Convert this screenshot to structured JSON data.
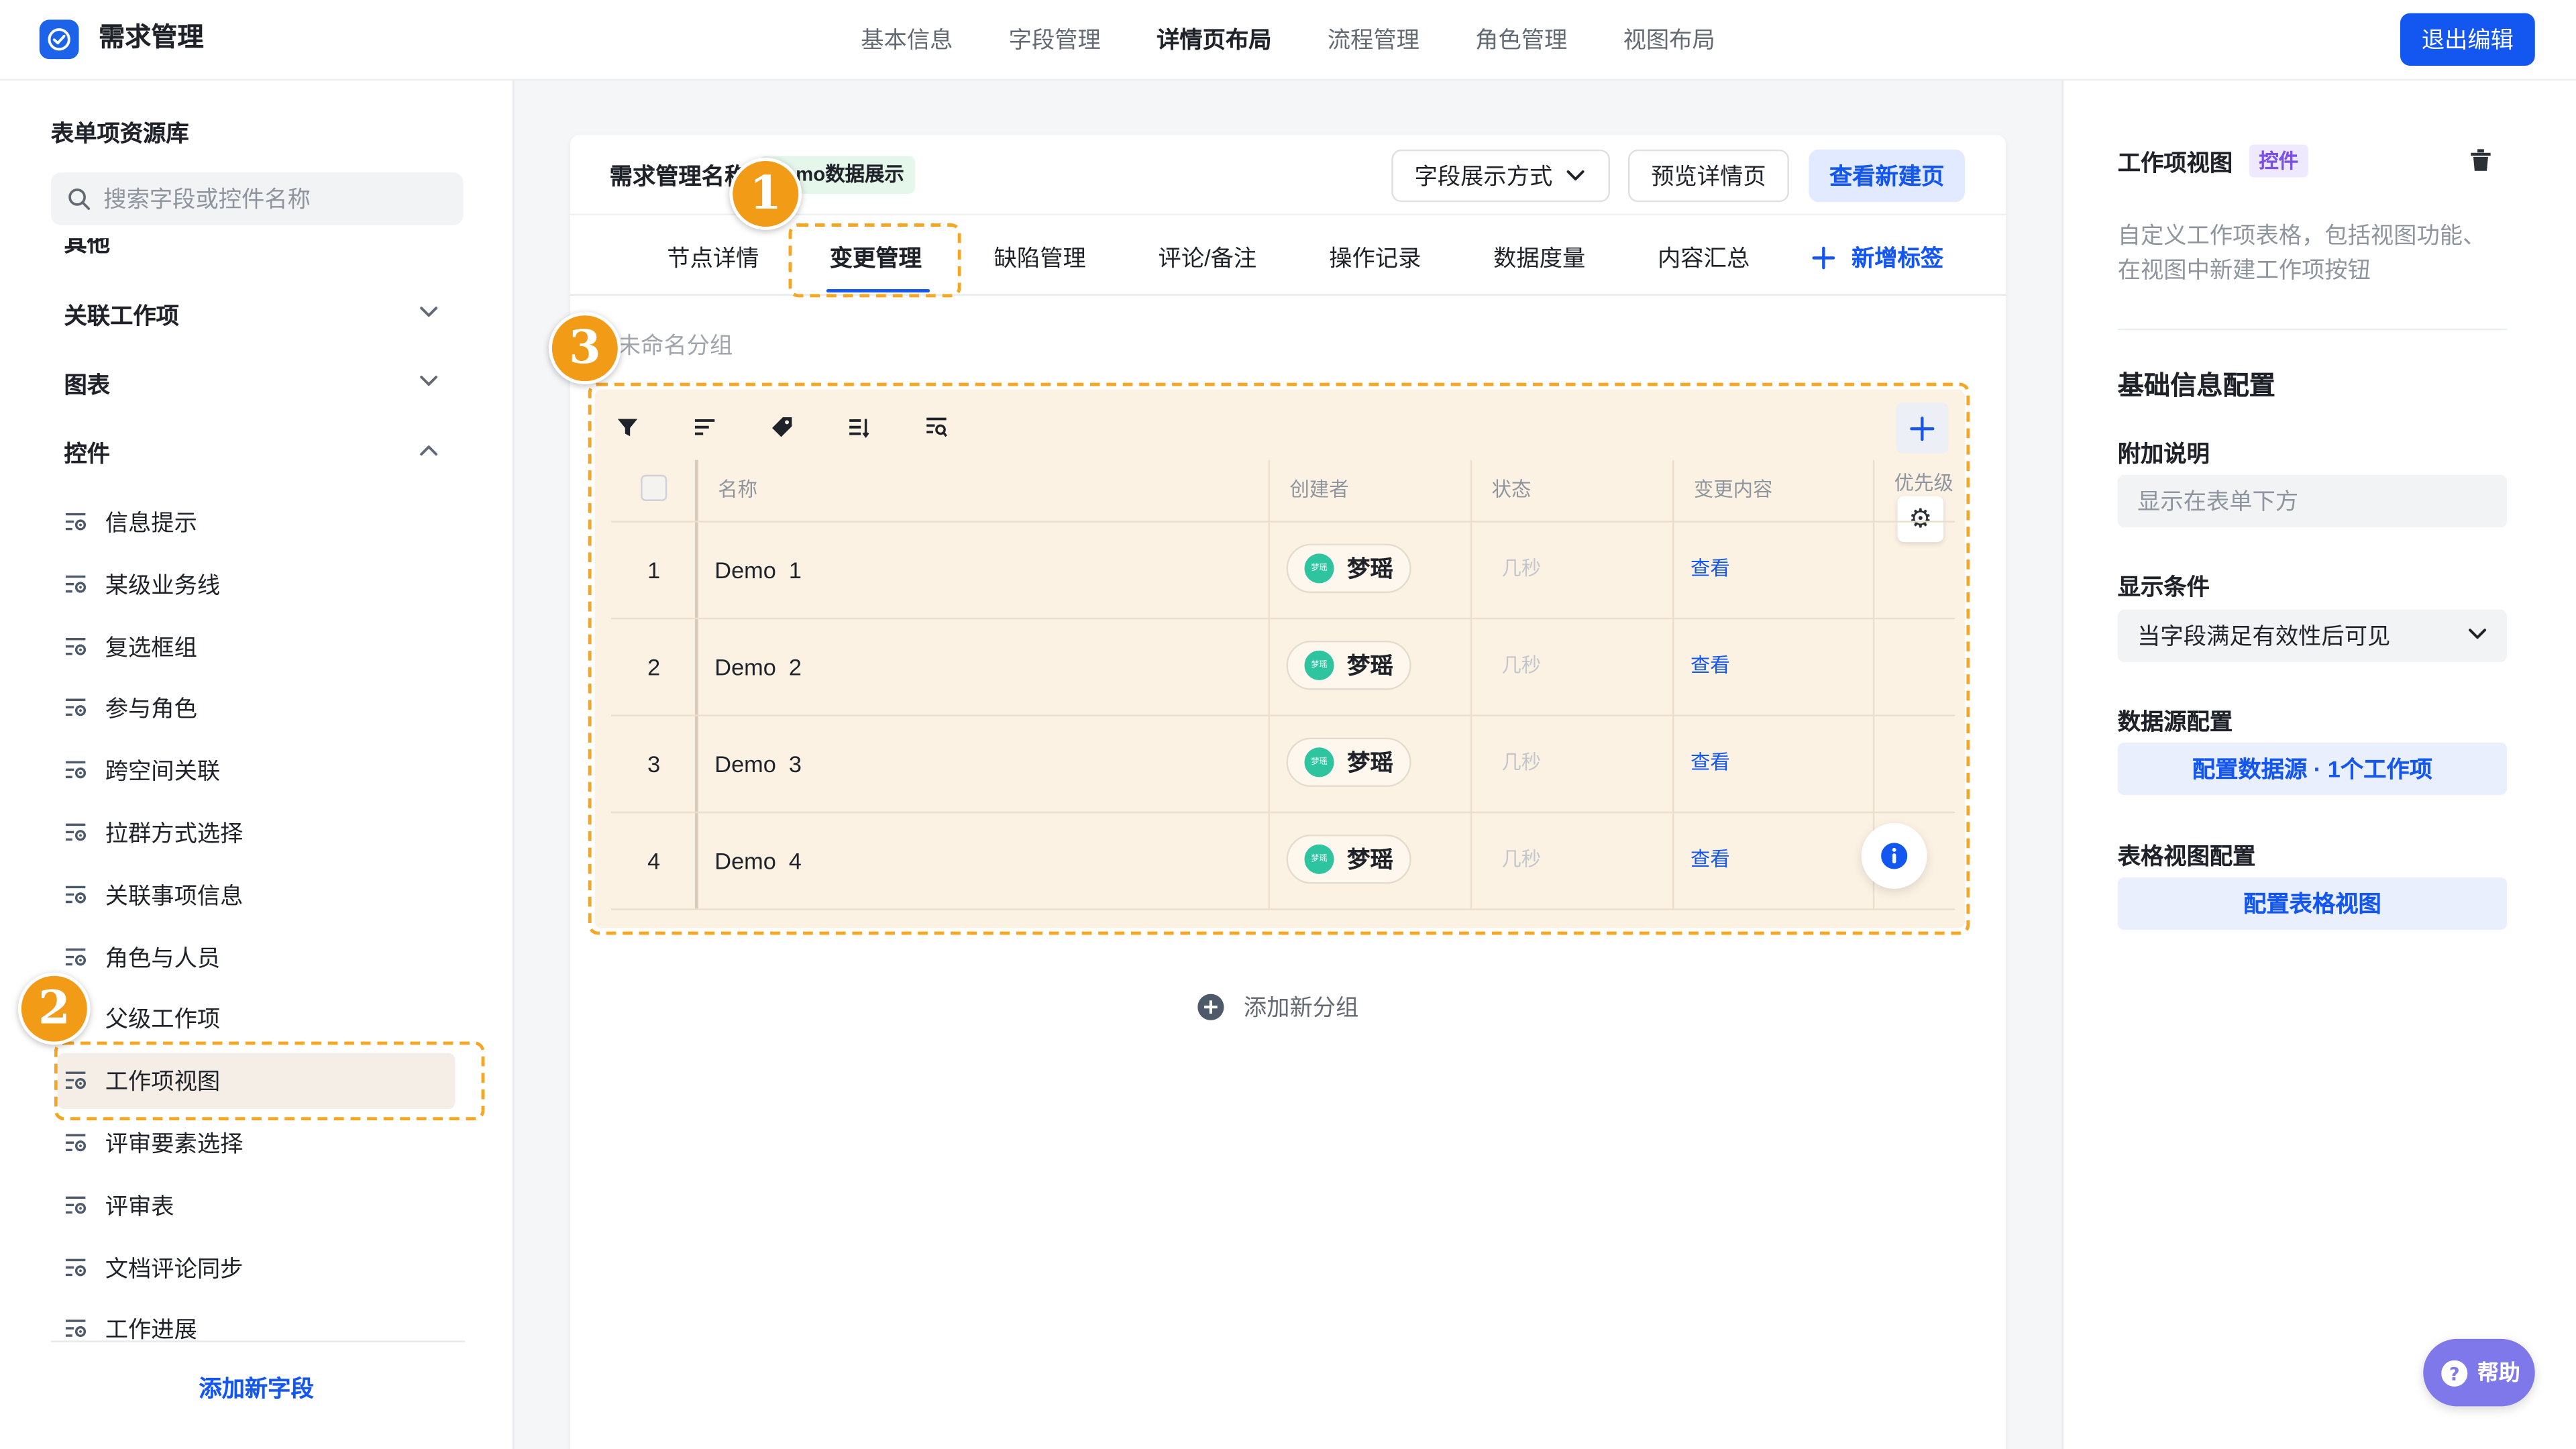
{
  "app": {
    "title": "需求管理",
    "logo_icon": "check-circle-icon"
  },
  "top_nav": {
    "items": [
      {
        "label": "基本信息",
        "active": false
      },
      {
        "label": "字段管理",
        "active": false
      },
      {
        "label": "详情页布局",
        "active": true
      },
      {
        "label": "流程管理",
        "active": false
      },
      {
        "label": "角色管理",
        "active": false
      },
      {
        "label": "视图布局",
        "active": false
      }
    ],
    "exit_button": "退出编辑"
  },
  "sidebar": {
    "title": "表单项资源库",
    "search": {
      "placeholder": "搜索字段或控件名称",
      "icon": "search-icon"
    },
    "partial_item": "其他",
    "groups": [
      {
        "label": "关联工作项",
        "expanded": false
      },
      {
        "label": "图表",
        "expanded": false
      },
      {
        "label": "控件",
        "expanded": true
      }
    ],
    "controls": [
      "信息提示",
      "某级业务线",
      "复选框组",
      "参与角色",
      "跨空间关联",
      "拉群方式选择",
      "关联事项信息",
      "角色与人员",
      "父级工作项",
      "工作项视图",
      "评审要素选择",
      "评审表",
      "文档评论同步",
      "工作进展"
    ],
    "selected_index": 9,
    "add_field": "添加新字段"
  },
  "annotations": {
    "markers": [
      "1",
      "2",
      "3"
    ]
  },
  "card": {
    "title": "需求管理名称",
    "demo_badge": "Demo数据展示",
    "field_display_button": "字段展示方式",
    "preview_button": "预览详情页",
    "view_create_button": "查看新建页",
    "tabs": [
      {
        "label": "节点详情",
        "active": false
      },
      {
        "label": "变更管理",
        "active": true
      },
      {
        "label": "缺陷管理",
        "active": false
      },
      {
        "label": "评论/备注",
        "active": false
      },
      {
        "label": "操作记录",
        "active": false
      },
      {
        "label": "数据度量",
        "active": false
      },
      {
        "label": "内容汇总",
        "active": false
      }
    ],
    "add_tab": "新增标签",
    "group_name": "未命名分组",
    "add_group": "添加新分组",
    "toolbar_icons": [
      "filter-icon",
      "sort-icon",
      "tag-icon",
      "group-by-icon",
      "field-search-icon"
    ]
  },
  "table": {
    "columns": [
      "名称",
      "创建者",
      "状态",
      "变更内容",
      "优先级"
    ],
    "rows": [
      {
        "index": "1",
        "name": "Demo  1",
        "avatar_text": "梦瑶",
        "creator": "梦瑶",
        "status": "几秒",
        "change": "查看"
      },
      {
        "index": "2",
        "name": "Demo  2",
        "avatar_text": "梦瑶",
        "creator": "梦瑶",
        "status": "几秒",
        "change": "查看"
      },
      {
        "index": "3",
        "name": "Demo  3",
        "avatar_text": "梦瑶",
        "creator": "梦瑶",
        "status": "几秒",
        "change": "查看"
      },
      {
        "index": "4",
        "name": "Demo  4",
        "avatar_text": "梦瑶",
        "creator": "梦瑶",
        "status": "几秒",
        "change": "查看"
      }
    ]
  },
  "right_panel": {
    "title": "工作项视图",
    "type_badge": "控件",
    "delete_icon": "trash-icon",
    "description": "自定义工作项表格，包括视图功能、在视图中新建工作项按钮",
    "section_title": "基础信息配置",
    "extra_note": {
      "label": "附加说明",
      "placeholder": "显示在表单下方"
    },
    "display_condition": {
      "label": "显示条件",
      "value": "当字段满足有效性后可见"
    },
    "data_source": {
      "label": "数据源配置",
      "button": "配置数据源 · 1个工作项"
    },
    "table_view": {
      "label": "表格视图配置",
      "button": "配置表格视图"
    }
  },
  "help": {
    "label": "帮助",
    "icon": "question-circle-icon"
  },
  "colors": {
    "primary": "#1456f0",
    "annotation": "#f5a623",
    "avatar": "#2ec4a0",
    "badge_purple": "#7b50e5",
    "help": "#7f78ea"
  }
}
